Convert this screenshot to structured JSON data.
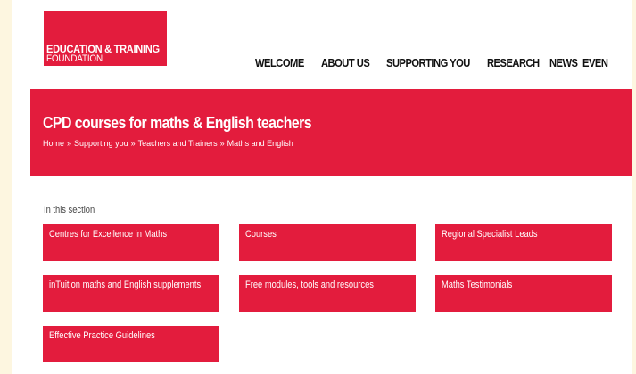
{
  "logo": {
    "line1": "EDUCATION & TRAINING",
    "line2": "FOUNDATION"
  },
  "nav": {
    "items": [
      "WELCOME",
      "ABOUT US",
      "SUPPORTING YOU",
      "RESEARCH",
      "NEWS",
      "EVEN"
    ]
  },
  "banner": {
    "title": "CPD courses for maths & English teachers",
    "breadcrumb": [
      "Home",
      "Supporting you",
      "Teachers and Trainers",
      "Maths and English"
    ],
    "separator": "»"
  },
  "section": {
    "label": "In this section",
    "tiles": [
      "Centres for Excellence in Maths",
      "Courses",
      "Regional Specialist Leads",
      "inTuition maths and English supplements",
      "Free modules, tools and resources",
      "Maths Testimonials",
      "Effective Practice Guidelines"
    ]
  },
  "colors": {
    "brand_red": "#e31c3d",
    "text_dark": "#111111",
    "background": "#ffffff",
    "outer_background": "#fdf6e0"
  }
}
